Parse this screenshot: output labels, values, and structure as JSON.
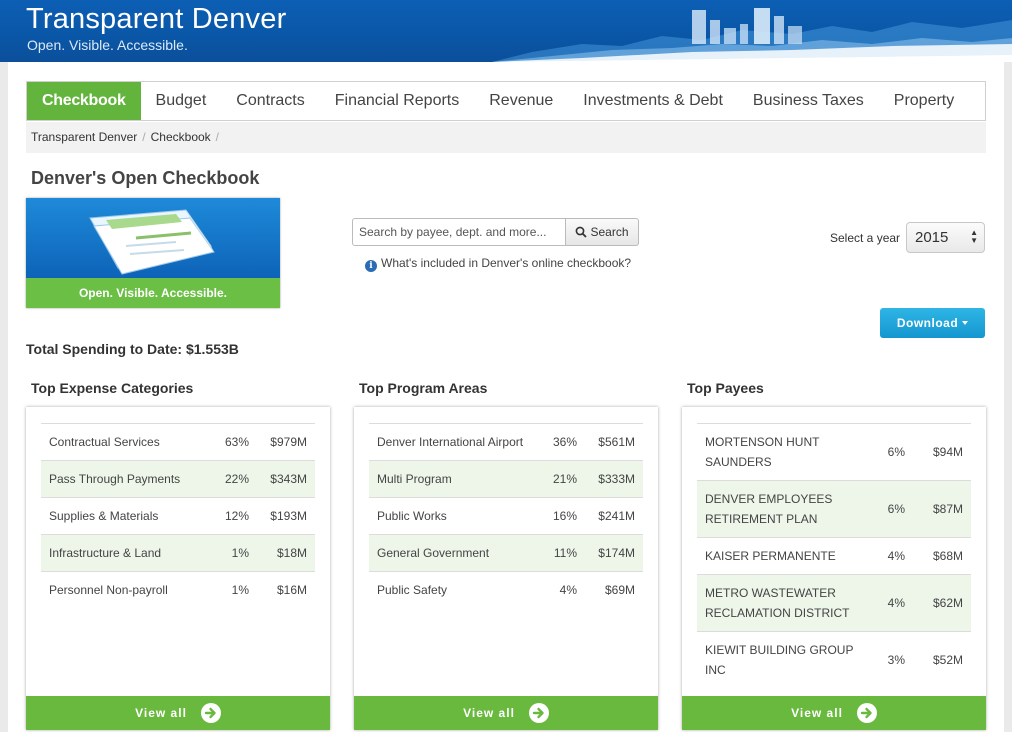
{
  "header": {
    "title": "Transparent Denver",
    "tagline": "Open. Visible. Accessible."
  },
  "nav": {
    "items": [
      {
        "label": "Checkbook",
        "active": true
      },
      {
        "label": "Budget"
      },
      {
        "label": "Contracts"
      },
      {
        "label": "Financial Reports"
      },
      {
        "label": "Revenue"
      },
      {
        "label": "Investments & Debt"
      },
      {
        "label": "Business Taxes"
      },
      {
        "label": "Property"
      }
    ]
  },
  "breadcrumb": [
    "Transparent Denver",
    "Checkbook"
  ],
  "page_title": "Denver's Open Checkbook",
  "hero_caption": "Open. Visible. Accessible.",
  "search": {
    "placeholder": "Search by payee, dept. and more...",
    "button_label": "Search",
    "info_link": "What's included in Denver's online checkbook?"
  },
  "year": {
    "label": "Select a year",
    "selected": "2015"
  },
  "download_label": "Download",
  "total_spending": "Total Spending to Date: $1.553B",
  "panels": [
    {
      "title": "Top Expense Categories",
      "rows": [
        {
          "name": "Contractual Services",
          "pct": "63%",
          "amount": "$979M"
        },
        {
          "name": "Pass Through Payments",
          "pct": "22%",
          "amount": "$343M"
        },
        {
          "name": "Supplies & Materials",
          "pct": "12%",
          "amount": "$193M"
        },
        {
          "name": "Infrastructure & Land",
          "pct": "1%",
          "amount": "$18M"
        },
        {
          "name": "Personnel Non-payroll",
          "pct": "1%",
          "amount": "$16M"
        }
      ],
      "view_all": "View all"
    },
    {
      "title": "Top Program Areas",
      "rows": [
        {
          "name": "Denver International Airport",
          "pct": "36%",
          "amount": "$561M"
        },
        {
          "name": "Multi Program",
          "pct": "21%",
          "amount": "$333M"
        },
        {
          "name": "Public Works",
          "pct": "16%",
          "amount": "$241M"
        },
        {
          "name": "General Government",
          "pct": "11%",
          "amount": "$174M"
        },
        {
          "name": "Public Safety",
          "pct": "4%",
          "amount": "$69M"
        }
      ],
      "view_all": "View all"
    },
    {
      "title": "Top Payees",
      "rows": [
        {
          "name": "MORTENSON HUNT SAUNDERS",
          "pct": "6%",
          "amount": "$94M"
        },
        {
          "name": "DENVER EMPLOYEES RETIREMENT PLAN",
          "pct": "6%",
          "amount": "$87M"
        },
        {
          "name": "KAISER PERMANENTE",
          "pct": "4%",
          "amount": "$68M"
        },
        {
          "name": "METRO WASTEWATER RECLAMATION DISTRICT",
          "pct": "4%",
          "amount": "$62M"
        },
        {
          "name": "KIEWIT BUILDING GROUP INC",
          "pct": "3%",
          "amount": "$52M"
        }
      ],
      "view_all": "View all"
    }
  ]
}
